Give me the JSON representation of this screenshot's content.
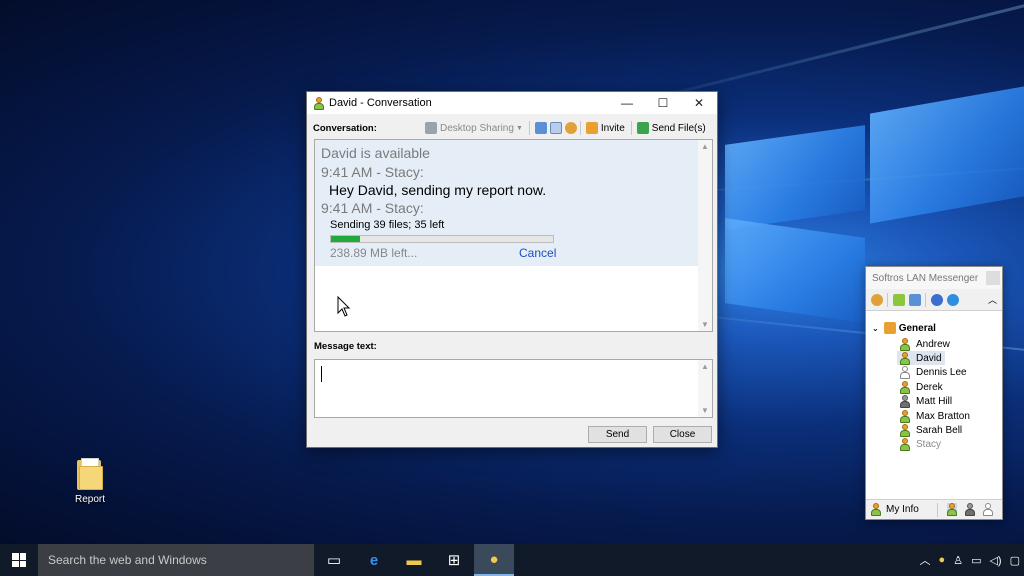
{
  "desktop": {
    "icon_label": "Report"
  },
  "conversation_window": {
    "title": "David - Conversation",
    "controls": {
      "minimize": "—",
      "maximize": "☐",
      "close": "✕"
    },
    "toolbar": {
      "label": "Conversation:",
      "desktop_sharing": "Desktop Sharing",
      "invite": "Invite",
      "send_files": "Send File(s)"
    },
    "history": {
      "status_line": "David is available",
      "message1_header": "9:41 AM - Stacy:",
      "message1_text": "Hey David, sending my report now.",
      "message2_header": "9:41 AM - Stacy:",
      "transfer_status": "Sending 39 files; 35 left",
      "transfer_progress_fraction": 0.13,
      "transfer_remaining": "238.89 MB left...",
      "cancel_link": "Cancel"
    },
    "message_label": "Message text:",
    "message_value": "",
    "send_button": "Send",
    "close_button": "Close"
  },
  "lan_messenger": {
    "title": "Softros LAN Messenger",
    "group": "General",
    "contacts": [
      {
        "name": "Andrew",
        "status": "available"
      },
      {
        "name": "David",
        "status": "available",
        "selected": true
      },
      {
        "name": "Dennis Lee",
        "status": "offline"
      },
      {
        "name": "Derek",
        "status": "available"
      },
      {
        "name": "Matt Hill",
        "status": "away"
      },
      {
        "name": "Max Bratton",
        "status": "available"
      },
      {
        "name": "Sarah Bell",
        "status": "available"
      },
      {
        "name": "Stacy",
        "status": "available-self"
      }
    ],
    "my_info": "My Info"
  },
  "taskbar": {
    "search_placeholder": "Search the web and Windows"
  },
  "colors": {
    "progress": "#1faa3b",
    "link": "#1a4fc4",
    "history_bg": "#e5eef7",
    "taskbar": "#101a28"
  }
}
